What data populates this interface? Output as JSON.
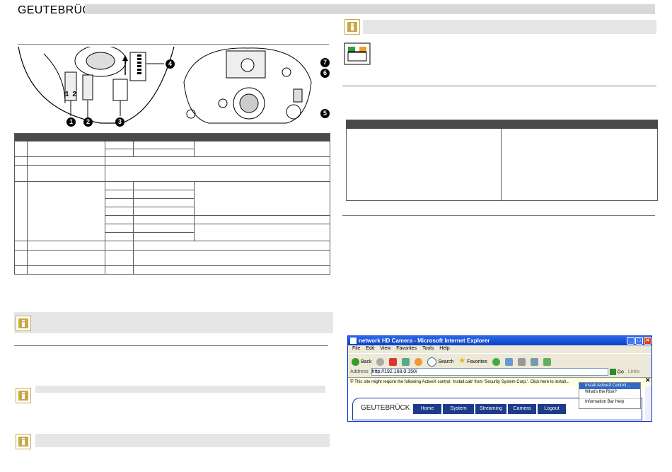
{
  "header": {
    "brand": "GEUTEBRÜCK"
  },
  "diagram": {
    "labels": [
      "1",
      "2"
    ],
    "badges": [
      "1",
      "2",
      "3",
      "4",
      "5",
      "6",
      "7"
    ]
  },
  "ie_window": {
    "title": "network HD Camera - Microsoft Internet Explorer",
    "menu": [
      "File",
      "Edit",
      "View",
      "Favorites",
      "Tools",
      "Help"
    ],
    "toolbar": {
      "back": "Back",
      "search": "Search",
      "favorites": "Favorites"
    },
    "address_label": "Address",
    "address_value": "http://192.168.0.150/",
    "go": "Go",
    "links": "Links",
    "infobar": "This site might require the following ActiveX control: 'install.cab' from 'Security System Corp.'. Click here to install...",
    "context_menu": [
      "Install ActiveX Control...",
      "What's the Risk?",
      "Information Bar Help"
    ],
    "page": {
      "logo": "GEUTEBRÜCK",
      "nav": [
        "Home",
        "System",
        "Streaming",
        "Camera",
        "Logout"
      ]
    }
  }
}
